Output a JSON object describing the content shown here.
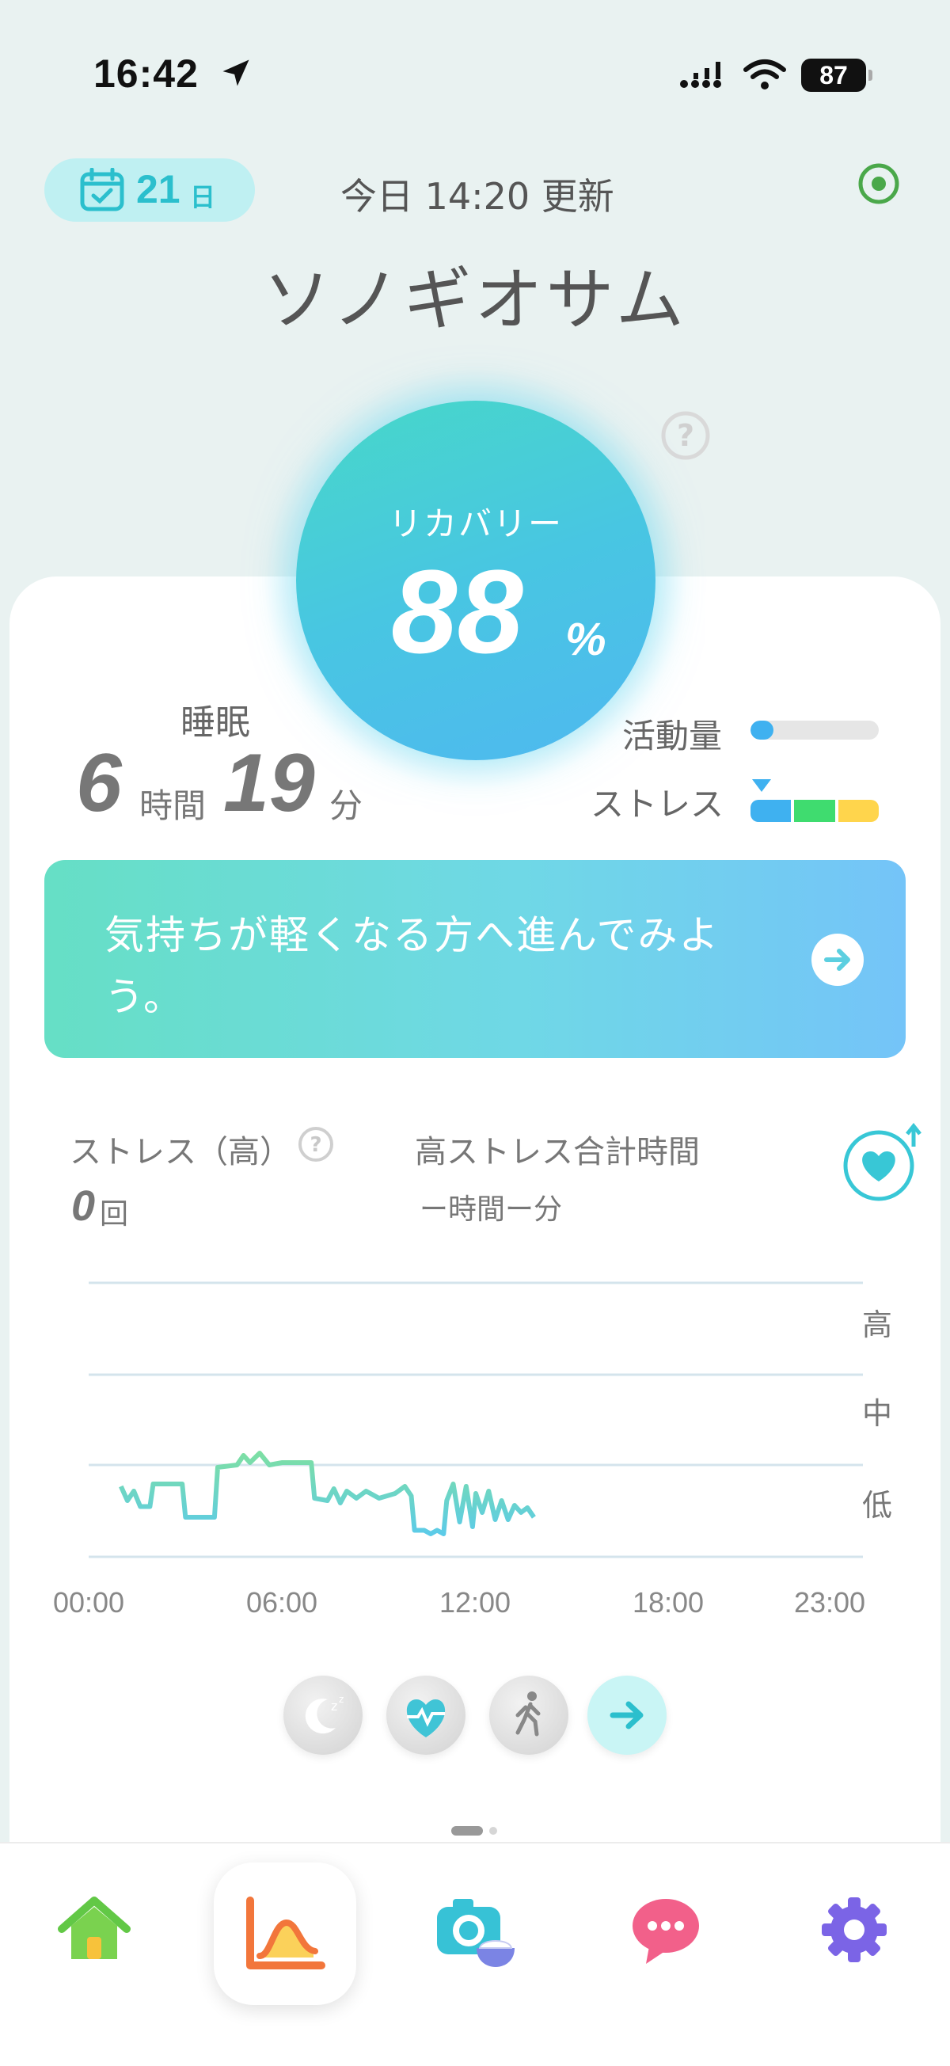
{
  "status_bar": {
    "time": "16:42",
    "battery": "87"
  },
  "header": {
    "day_count": "21",
    "day_unit": "日",
    "updated": "今日 14:20 更新",
    "user_name": "ソノギオサム"
  },
  "recovery": {
    "label": "リカバリー",
    "value": "88",
    "unit": "%",
    "percent": 88
  },
  "sleep": {
    "label": "睡眠",
    "hours": "6",
    "hours_unit": "時間",
    "minutes": "19",
    "minutes_unit": "分"
  },
  "activity": {
    "label": "活動量",
    "level": 0.18
  },
  "stress_meter": {
    "label": "ストレス",
    "segment_colors": [
      "#3fb1f0",
      "#3fdc6f",
      "#ffd54c"
    ]
  },
  "message": {
    "text": "気持ちが軽くなる方へ進んでみよう。"
  },
  "stress_stats": {
    "count_label": "ストレス（高）",
    "count": "0",
    "count_unit": "回",
    "total_label": "高ストレス合計時間",
    "total_value": "ー時間ー分"
  },
  "chart_data": {
    "type": "line",
    "x_ticks": [
      "00:00",
      "06:00",
      "12:00",
      "18:00",
      "23:00"
    ],
    "y_levels": [
      "高",
      "中",
      "低"
    ],
    "x_range_hours": [
      0,
      23
    ],
    "series": [
      {
        "points": [
          [
            1.0,
            0.42
          ],
          [
            1.2,
            0.3
          ],
          [
            1.4,
            0.38
          ],
          [
            1.6,
            0.25
          ],
          [
            1.9,
            0.25
          ],
          [
            2.0,
            0.44
          ],
          [
            2.6,
            0.44
          ],
          [
            2.9,
            0.44
          ],
          [
            3.0,
            0.16
          ],
          [
            3.5,
            0.16
          ],
          [
            3.9,
            0.16
          ],
          [
            4.0,
            0.58
          ],
          [
            4.6,
            0.6
          ],
          [
            4.8,
            0.68
          ],
          [
            5.0,
            0.62
          ],
          [
            5.3,
            0.7
          ],
          [
            5.6,
            0.6
          ],
          [
            6.0,
            0.62
          ],
          [
            6.3,
            0.62
          ],
          [
            6.9,
            0.62
          ],
          [
            7.0,
            0.32
          ],
          [
            7.4,
            0.3
          ],
          [
            7.6,
            0.4
          ],
          [
            7.8,
            0.28
          ],
          [
            8.0,
            0.38
          ],
          [
            8.3,
            0.32
          ],
          [
            8.6,
            0.38
          ],
          [
            9.0,
            0.32
          ],
          [
            9.5,
            0.36
          ],
          [
            9.8,
            0.42
          ],
          [
            10.0,
            0.34
          ],
          [
            10.1,
            0.05
          ],
          [
            10.4,
            0.05
          ],
          [
            10.6,
            0.02
          ],
          [
            10.8,
            0.05
          ],
          [
            11.0,
            0.02
          ],
          [
            11.1,
            0.3
          ],
          [
            11.3,
            0.44
          ],
          [
            11.5,
            0.12
          ],
          [
            11.7,
            0.42
          ],
          [
            11.9,
            0.08
          ],
          [
            12.0,
            0.36
          ],
          [
            12.2,
            0.2
          ],
          [
            12.4,
            0.38
          ],
          [
            12.6,
            0.14
          ],
          [
            12.8,
            0.3
          ],
          [
            13.0,
            0.14
          ],
          [
            13.2,
            0.26
          ],
          [
            13.4,
            0.2
          ],
          [
            13.6,
            0.24
          ],
          [
            13.8,
            0.16
          ]
        ],
        "colors": [
          "#5ccbe8",
          "#7ddfa4"
        ]
      }
    ],
    "grid": true
  },
  "mode_buttons": [
    {
      "name": "sleep-mode-button",
      "icon": "moon-zz-icon"
    },
    {
      "name": "heart-mode-button",
      "icon": "heart-pulse-icon"
    },
    {
      "name": "walk-mode-button",
      "icon": "walking-icon"
    },
    {
      "name": "next-mode-button",
      "icon": "arrow-right-icon"
    }
  ],
  "tabs": [
    {
      "name": "tab-home",
      "icon": "home-icon"
    },
    {
      "name": "tab-chart",
      "icon": "chart-icon"
    },
    {
      "name": "tab-camera",
      "icon": "camera-food-icon"
    },
    {
      "name": "tab-chat",
      "icon": "chat-icon"
    },
    {
      "name": "tab-settings",
      "icon": "gear-icon"
    }
  ]
}
